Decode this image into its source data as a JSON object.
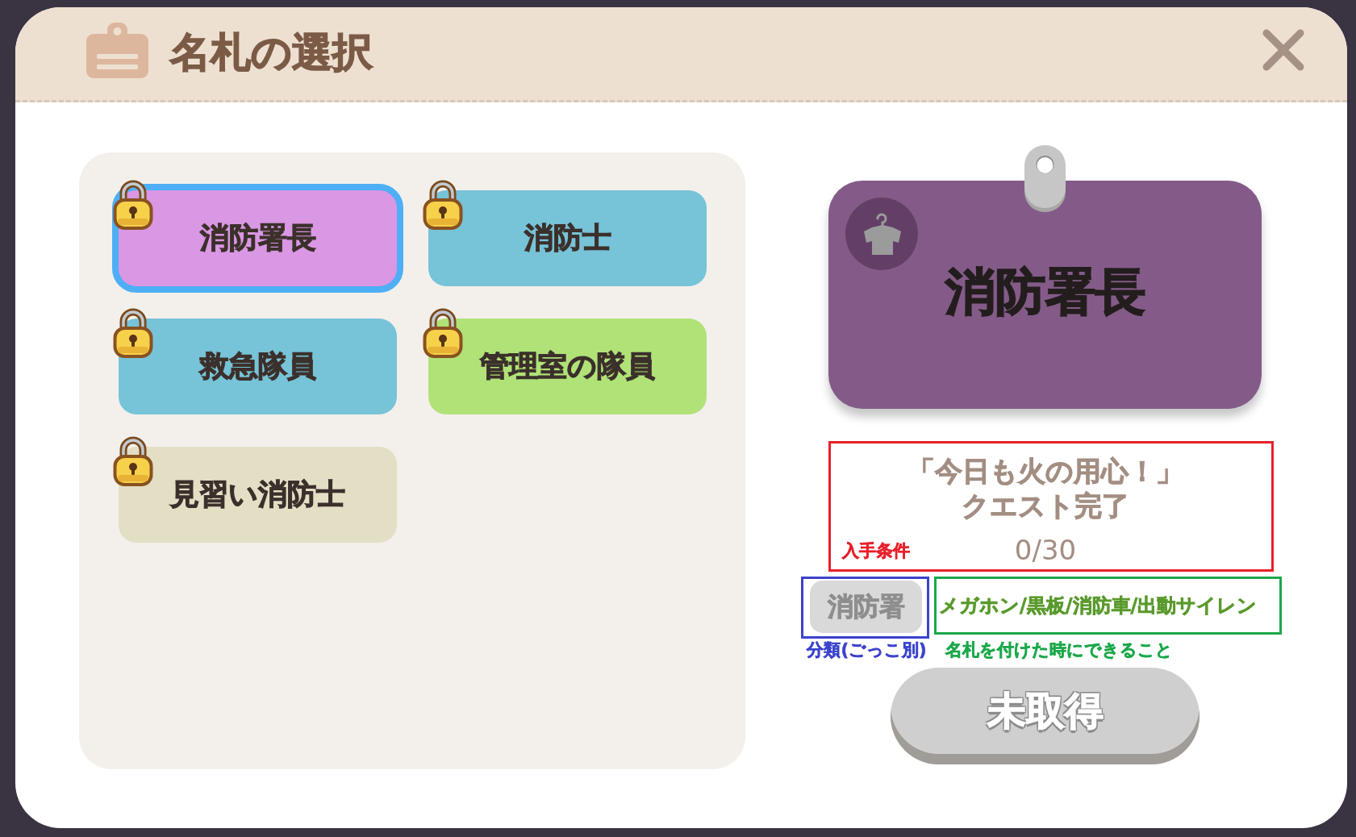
{
  "dialog": {
    "title": "名札の選択"
  },
  "name_tags": [
    {
      "label": "消防署長",
      "color": "#da97e3",
      "selected": true,
      "locked": true
    },
    {
      "label": "消防士",
      "color": "#77c3d8",
      "selected": false,
      "locked": true
    },
    {
      "label": "救急隊員",
      "color": "#77c3d8",
      "selected": false,
      "locked": true
    },
    {
      "label": "管理室の隊員",
      "color": "#b1e278",
      "selected": false,
      "locked": true
    },
    {
      "label": "見習い消防士",
      "color": "#e2dfc5",
      "selected": false,
      "locked": true
    }
  ],
  "detail": {
    "title": "消防署長",
    "condition": {
      "lines": [
        "「今日も火の用心！」",
        "クエスト完了"
      ],
      "progress": "0/30",
      "annotation": {
        "label": "入手条件",
        "color": "#e8202a"
      }
    },
    "category": {
      "label": "消防署",
      "annotation": {
        "label": "分類(ごっこ別)",
        "color": "#3b43cc"
      }
    },
    "abilities": {
      "text": "メガホン/黒板/消防車/出動サイレン",
      "annotation": {
        "label": "名札を付けた時にできること",
        "color": "#1ba84a"
      }
    },
    "action": {
      "label": "未取得",
      "disabled": true
    }
  }
}
